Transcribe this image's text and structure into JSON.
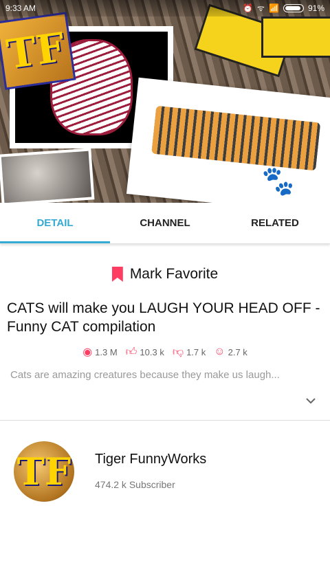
{
  "status_bar": {
    "time": "9:33 AM",
    "battery": "91%"
  },
  "banner": {
    "logo_text": "TF"
  },
  "tabs": [
    {
      "label": "DETAIL",
      "active": true
    },
    {
      "label": "CHANNEL",
      "active": false
    },
    {
      "label": "RELATED",
      "active": false
    }
  ],
  "favorite": {
    "label": "Mark Favorite"
  },
  "video": {
    "title": "CATS will make you LAUGH YOUR HEAD OFF - Funny CAT compilation",
    "description": "Cats are amazing creatures because they make us laugh..."
  },
  "stats": {
    "views": "1.3 M",
    "likes": "10.3 k",
    "dislikes": "1.7 k",
    "smiles": "2.7 k"
  },
  "channel": {
    "name": "Tiger FunnyWorks",
    "subscribers": "474.2 k Subscriber",
    "avatar_text": "TF"
  },
  "colors": {
    "accent": "#34a9d3",
    "pink": "#ff3d63"
  }
}
